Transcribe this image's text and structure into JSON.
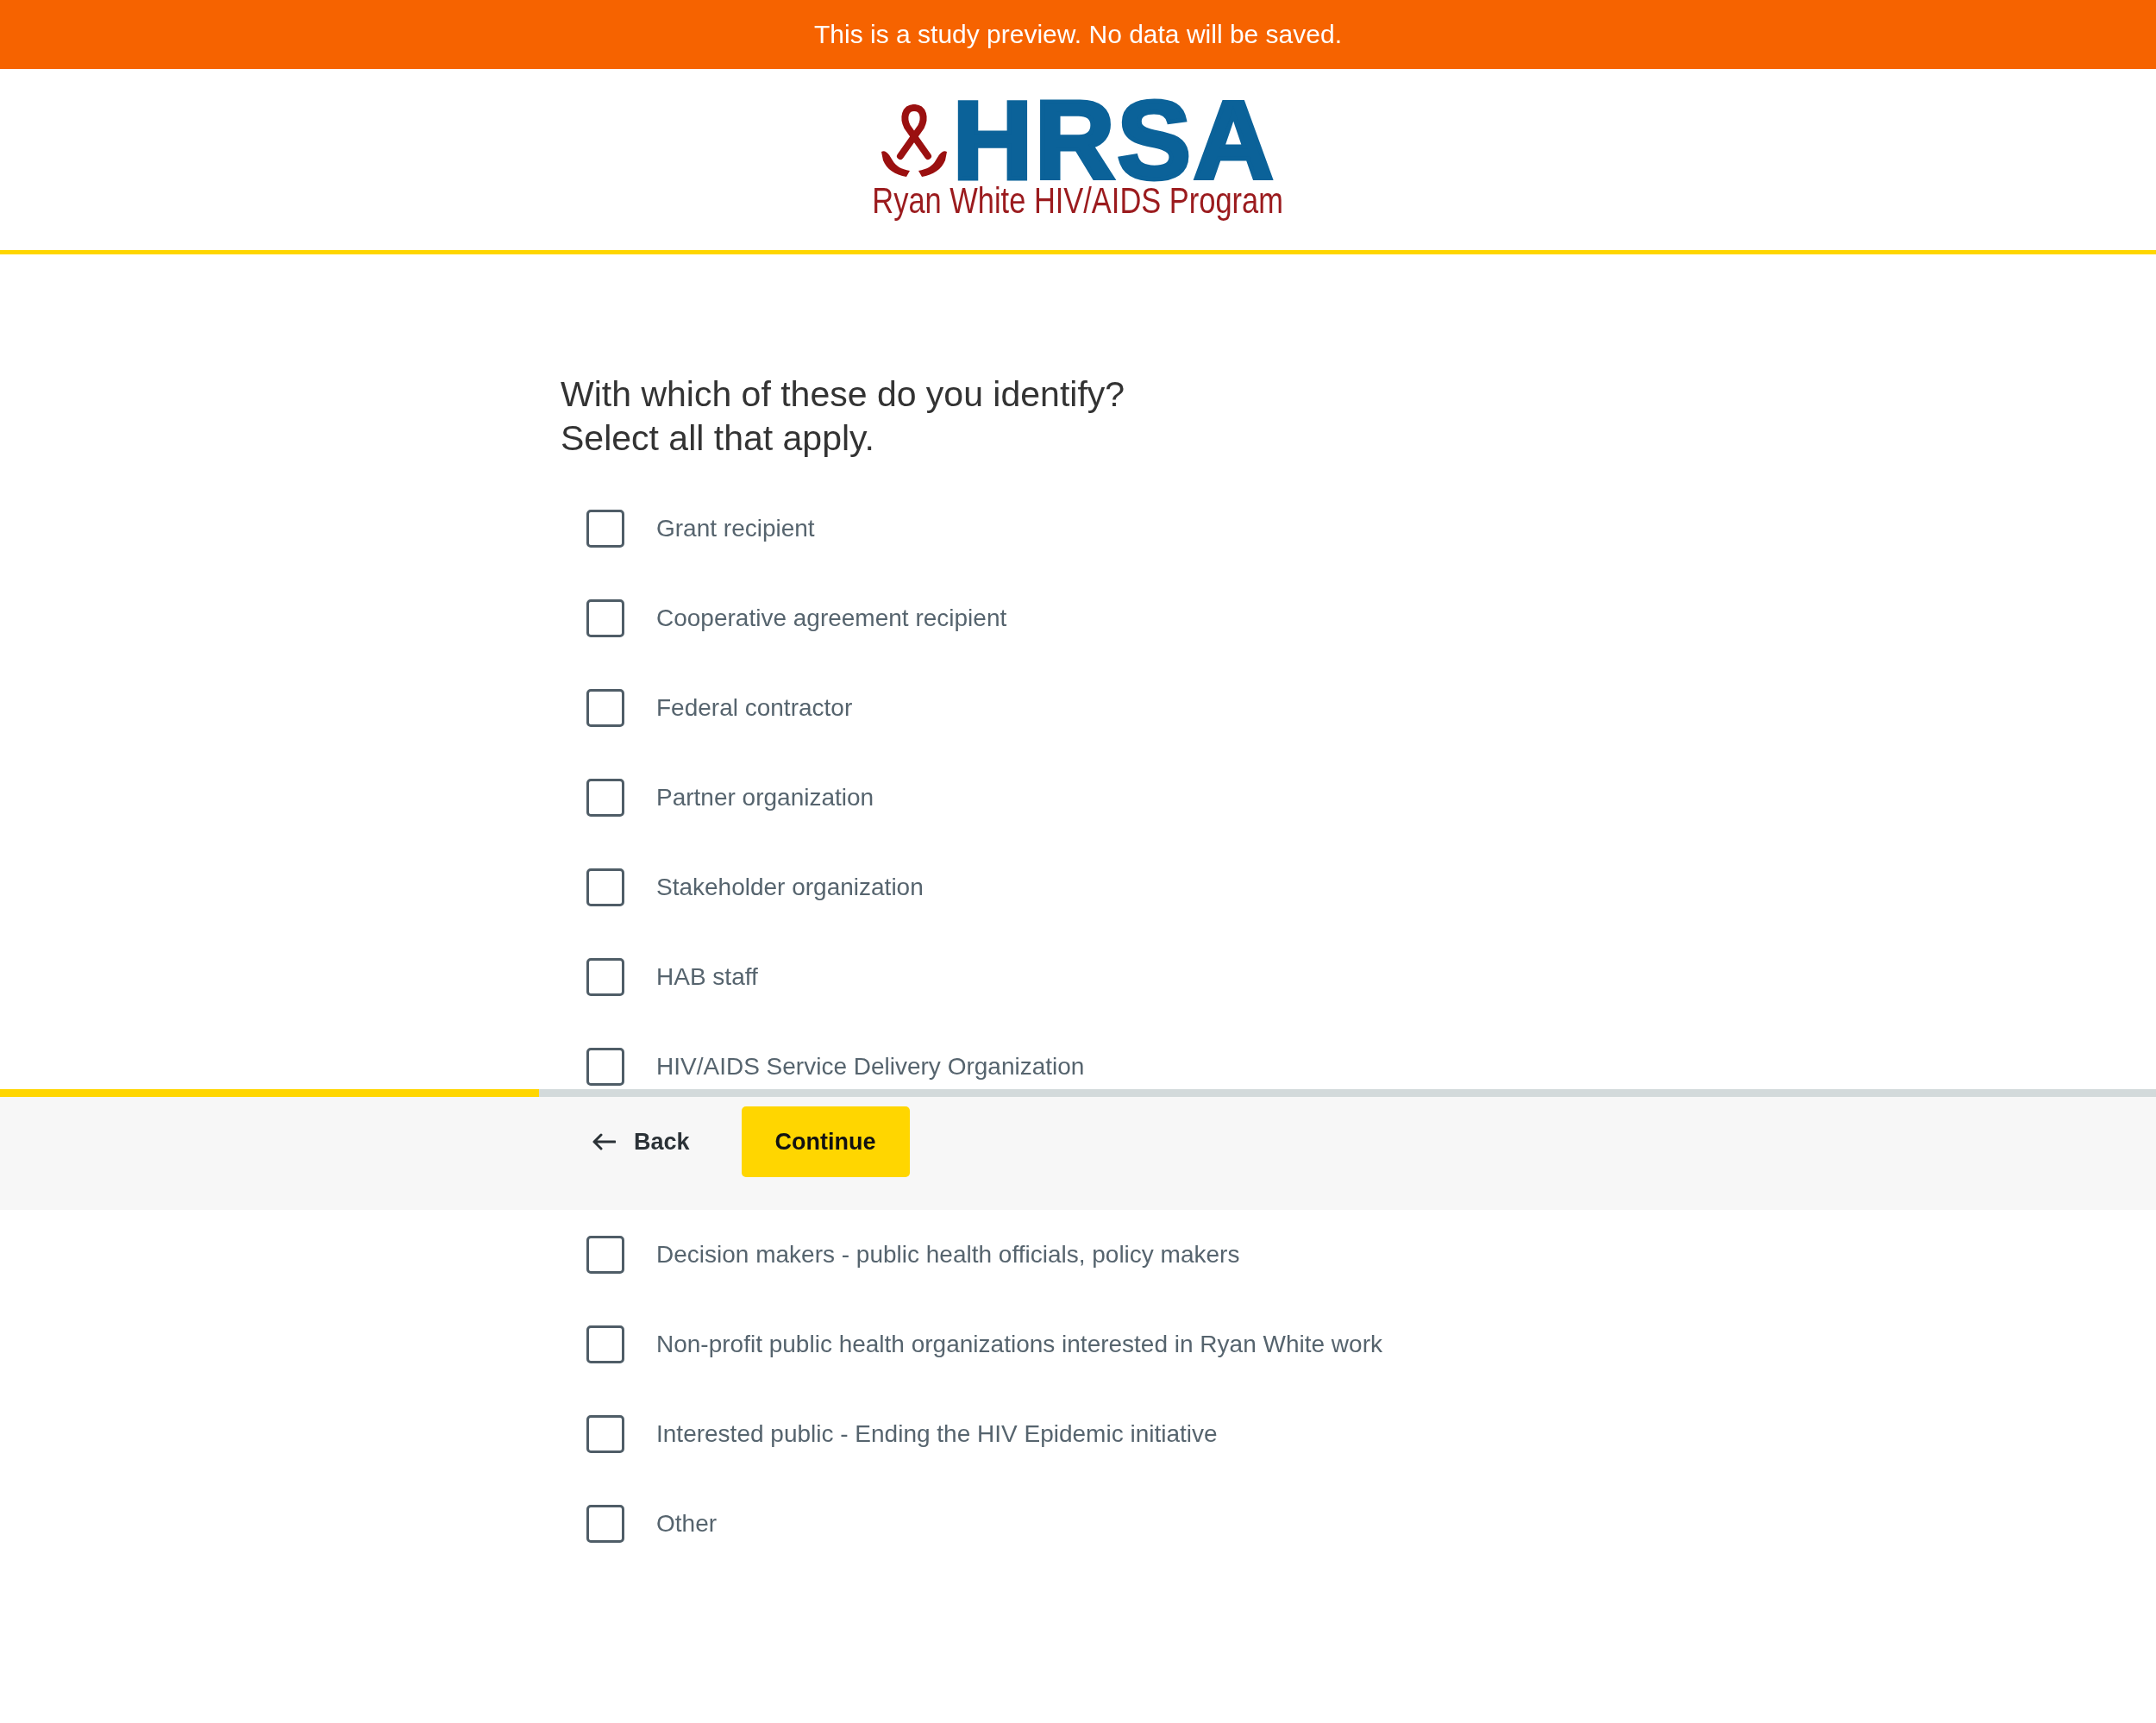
{
  "banner": {
    "text": "This is a study preview. No data will be saved."
  },
  "header": {
    "logo": {
      "wordmark": "HRSA",
      "subtitle": "Ryan White HIV/AIDS Program"
    }
  },
  "question": {
    "title": "With which of these do you identify?",
    "instruction": "Select all that apply."
  },
  "options": [
    {
      "label": "Grant recipient",
      "checked": false,
      "kind": "full"
    },
    {
      "label": "Cooperative agreement recipient",
      "checked": false,
      "kind": "full"
    },
    {
      "label": "Federal contractor",
      "checked": false,
      "kind": "full"
    },
    {
      "label": "Partner organization",
      "checked": false,
      "kind": "full"
    },
    {
      "label": "Stakeholder organization",
      "checked": false,
      "kind": "full"
    },
    {
      "label": "HAB staff",
      "checked": false,
      "kind": "full"
    },
    {
      "label": "HIV/AIDS Service Delivery Organization",
      "checked": false,
      "kind": "covered"
    }
  ],
  "footer": {
    "progress": {
      "level": 0.25
    },
    "back": {
      "label": "Back"
    },
    "continue": {
      "label": "Continue"
    }
  },
  "options_continued": [
    {
      "label": "Decision makers - public health officials, policy makers",
      "checked": false
    },
    {
      "label": "Non-profit public health organizations interested in Ryan White work",
      "checked": false
    },
    {
      "label": "Interested public - Ending the HIV Epidemic initiative",
      "checked": false
    },
    {
      "label": "Other",
      "checked": false
    }
  ]
}
